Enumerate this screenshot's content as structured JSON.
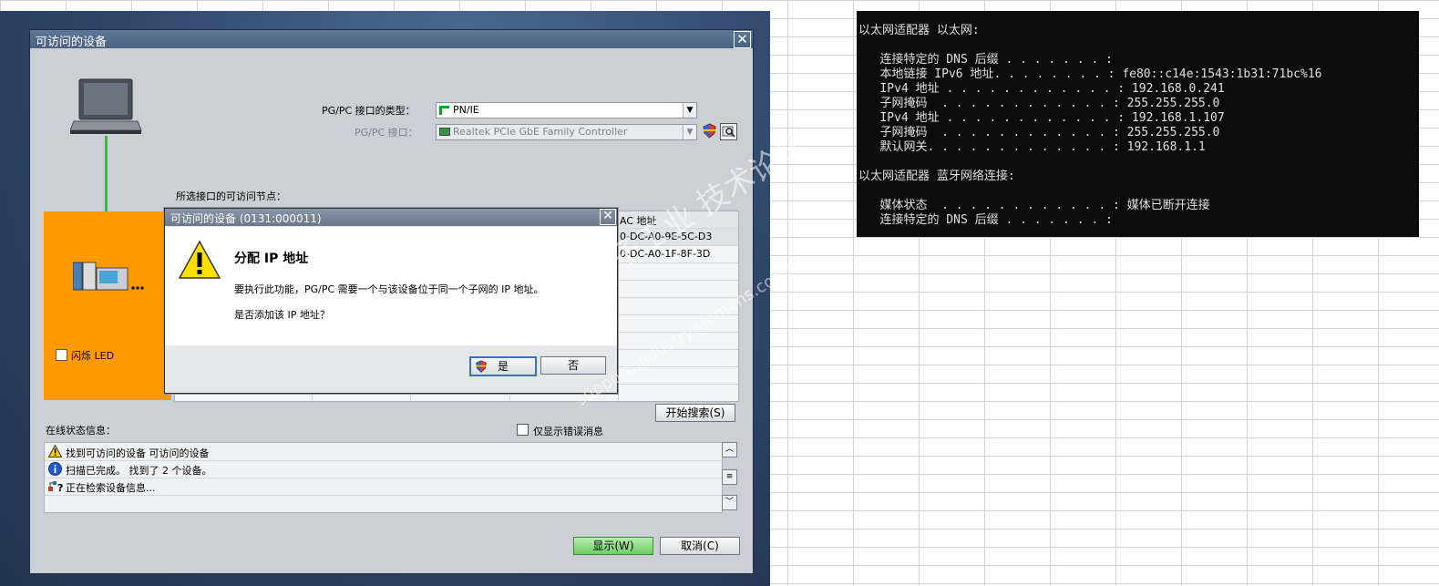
{
  "dialog": {
    "title": "可访问的设备",
    "close_glyph": "✕",
    "pgpc_type_label": "PG/PC 接口的类型：",
    "pgpc_type_value": "PN/IE",
    "pgpc_iface_label": "PG/PC 接口：",
    "pgpc_iface_value": "Realtek PCIe GbE Family Controller",
    "nodes_label": "所选接口的可访问节点：",
    "mac_header": "AC 地址",
    "mac_rows": [
      "0-DC-A0-9E-5C-D3",
      "0-DC-A0-1F-8F-3D"
    ],
    "flash_led": "闪烁 LED",
    "search_button": "开始搜索(S)",
    "online_status_label": "在线状态信息：",
    "only_errors": "仅显示错误消息",
    "status_rows": [
      "找到可访问的设备 可访问的设备",
      "扫描已完成。 找到了 2 个设备。",
      "正在检索设备信息..."
    ],
    "display_button": "显示(W)",
    "cancel_button": "取消(C)"
  },
  "popup": {
    "title": "可访问的设备 (0131:000011)",
    "heading": "分配 IP 地址",
    "message": "要执行此功能，PG/PC 需要一个与该设备位于同一个子网的 IP 地址。",
    "question": "是否添加该 IP 地址？",
    "yes_button": "是",
    "no_button": "否"
  },
  "terminal": {
    "lines": [
      "以太网适配器 以太网:",
      "",
      "   连接特定的 DNS 后缀 . . . . . . . :",
      "   本地链接 IPv6 地址. . . . . . . . : fe80::c14e:1543:1b31:71bc%16",
      "   IPv4 地址 . . . . . . . . . . . . : 192.168.0.241",
      "   子网掩码  . . . . . . . . . . . . : 255.255.255.0",
      "   IPv4 地址 . . . . . . . . . . . . : 192.168.1.107",
      "   子网掩码  . . . . . . . . . . . . : 255.255.255.0",
      "   默认网关. . . . . . . . . . . . . : 192.168.1.1",
      "",
      "以太网适配器 蓝牙网络连接:",
      "",
      "   媒体状态  . . . . . . . . . . . . : 媒体已断开连接",
      "   连接特定的 DNS 后缀 . . . . . . . :"
    ]
  },
  "watermark": {
    "line1": "西门子工业 技术论坛",
    "line2": "support.industry.siemens.com/cs"
  },
  "colors": {
    "title_bar": "#4a6282",
    "orange_panel": "#ff9900",
    "link_green": "#22cc22",
    "terminal_bg": "#0c0c0c"
  }
}
